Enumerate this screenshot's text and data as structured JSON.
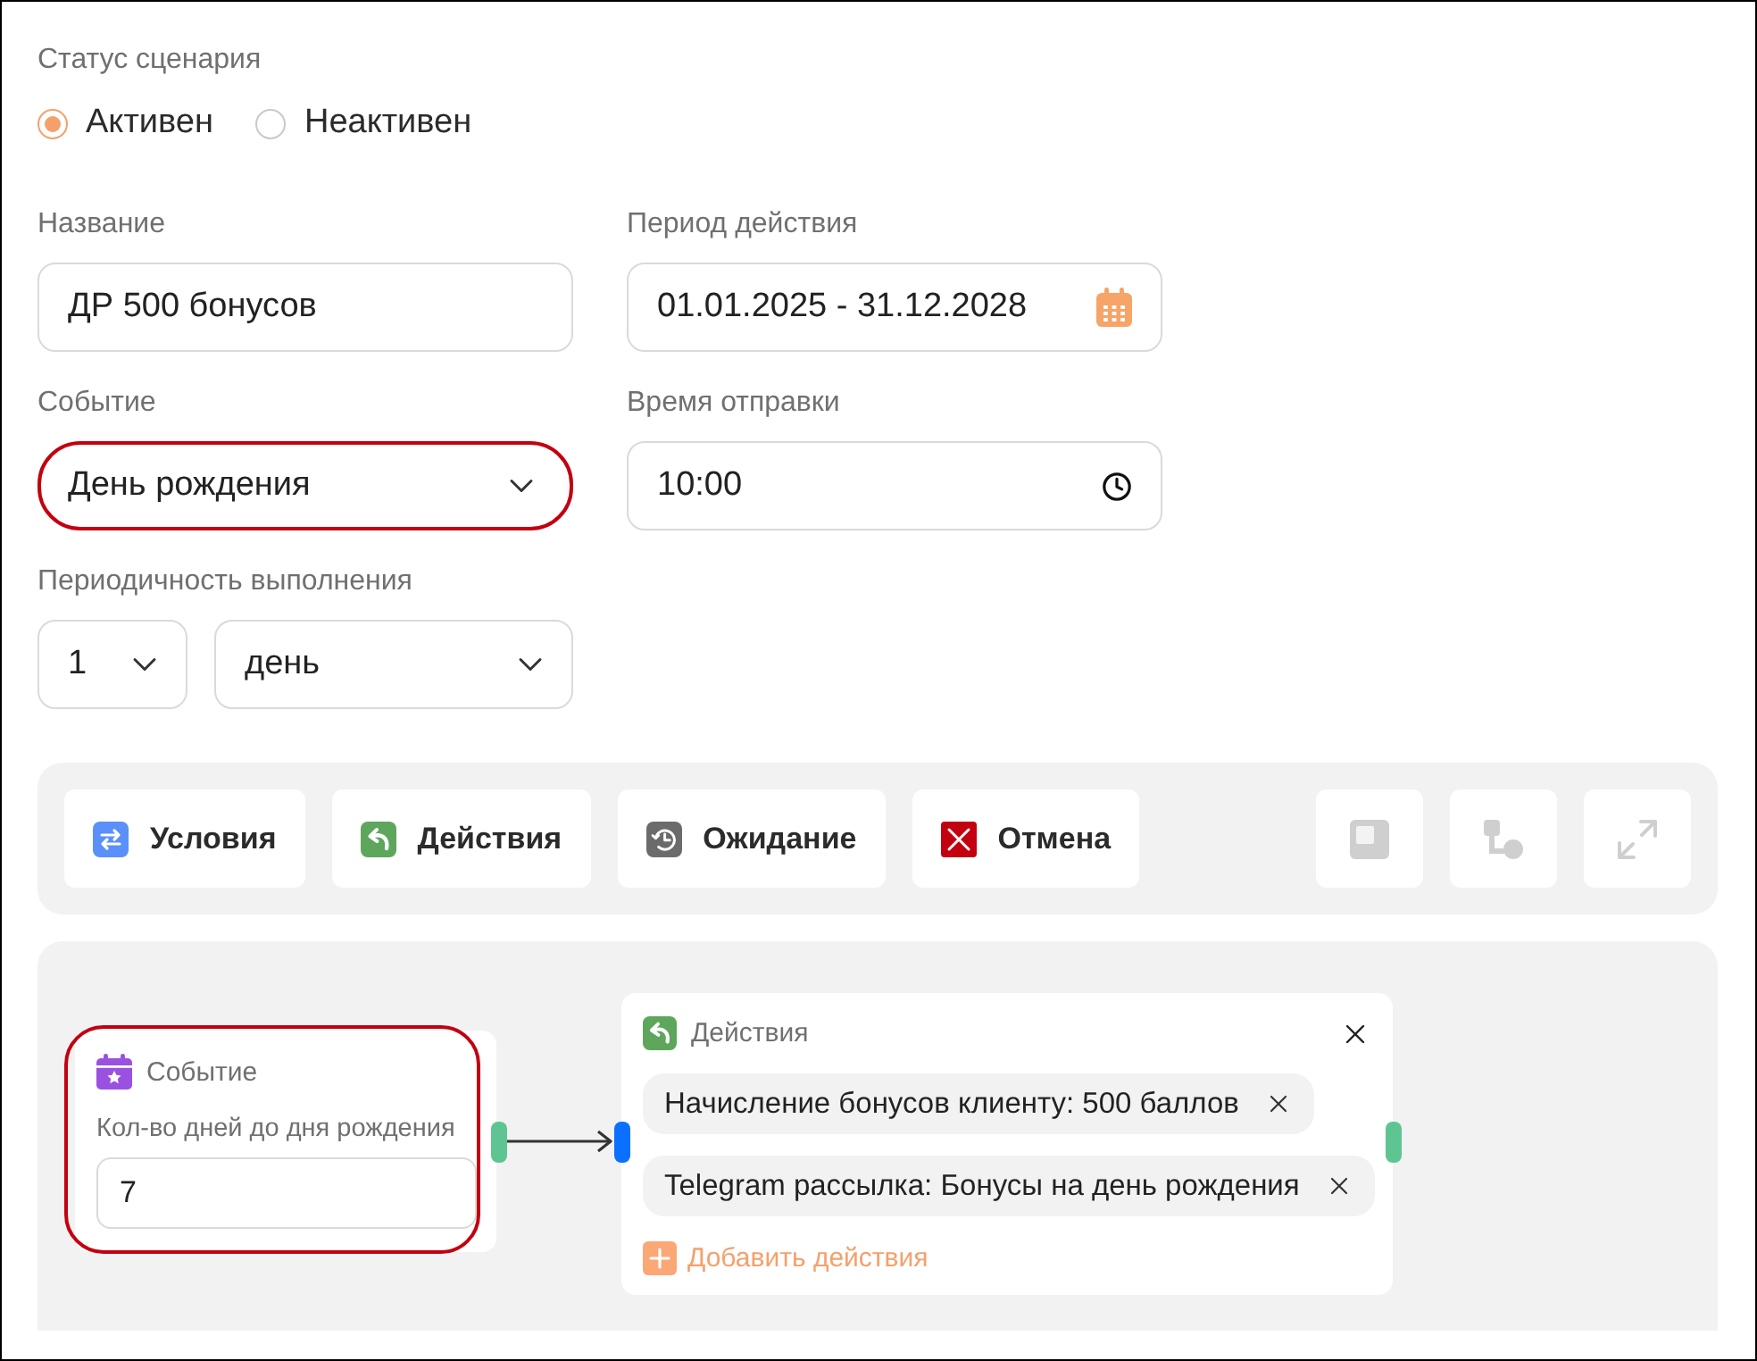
{
  "status": {
    "label": "Статус сценария",
    "options": [
      {
        "label": "Активен",
        "selected": true
      },
      {
        "label": "Неактивен",
        "selected": false
      }
    ]
  },
  "fields": [
    {
      "kind": "text",
      "label": "Название",
      "value": "ДР 500 бонусов",
      "highlighted": false
    },
    {
      "kind": "date",
      "label": "Период действия",
      "value": "01.01.2025 - 31.12.2028",
      "highlighted": false
    },
    {
      "kind": "select",
      "label": "Событие",
      "value": "День рождения",
      "highlighted": true
    },
    {
      "kind": "time",
      "label": "Время отправки",
      "value": "10:00",
      "highlighted": false
    }
  ],
  "periodicity": {
    "label": "Периодичность выполнения",
    "selects": [
      {
        "value": "1"
      },
      {
        "value": "день"
      }
    ]
  },
  "toolbar": {
    "buttons": [
      {
        "kind": "conditions",
        "label": "Условия"
      },
      {
        "kind": "actions",
        "label": "Действия"
      },
      {
        "kind": "wait",
        "label": "Ожидание"
      },
      {
        "kind": "cancel",
        "label": "Отмена"
      }
    ],
    "tools": [
      {
        "kind": "minimap",
        "disabled": true
      },
      {
        "kind": "layout",
        "disabled": true
      },
      {
        "kind": "fullscreen",
        "disabled": true
      }
    ]
  },
  "canvas": {
    "event_node": {
      "title": "Событие",
      "field_label": "Кол-во дней до дня рождения",
      "value": "7",
      "highlighted": true
    },
    "action_node": {
      "title": "Действия",
      "items": [
        {
          "label": "Начисление бонусов клиенту: 500 баллов"
        },
        {
          "label": "Telegram рассылка: Бонусы на день рождения"
        }
      ],
      "add_label": "Добавить действия"
    }
  }
}
